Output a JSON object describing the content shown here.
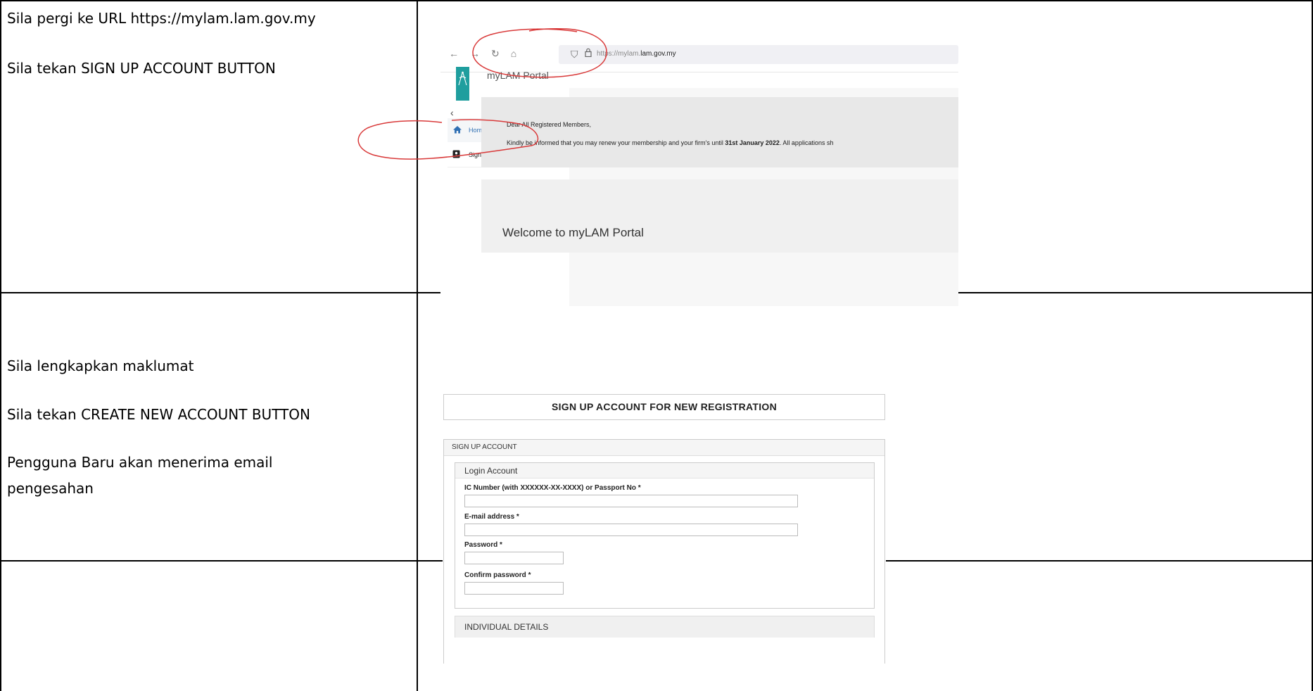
{
  "instructions": {
    "row1_step1": "Sila pergi ke URL https://mylam.lam.gov.my",
    "row1_step2": "Sila tekan SIGN UP ACCOUNT BUTTON",
    "row2_step1": "Sila lengkapkan maklumat",
    "row2_step2": "Sila tekan CREATE NEW ACCOUNT BUTTON",
    "row2_step3_line1": "Pengguna Baru akan menerima email",
    "row2_step3_line2": "pengesahan"
  },
  "browser": {
    "url_prefix": "https://mylam.",
    "url_domain": "lam.gov.my",
    "nav_icons": [
      "back-arrow-icon",
      "forward-arrow-icon",
      "reload-icon",
      "home-icon"
    ],
    "accent_color": "#2f6fb3",
    "logo_color": "#1f9e9e"
  },
  "portal": {
    "title": "myLAM Portal",
    "collapse_glyph": "‹",
    "sidebar": [
      {
        "label": "Home",
        "icon": "home-icon"
      },
      {
        "label": "Sign up Account",
        "icon": "contact-card-icon"
      }
    ],
    "notice_greeting": "Dear All Registered Members,",
    "notice_body_start": "Kindly be informed that you may renew your membership and your firm's until ",
    "notice_body_date": "31st January 2022",
    "notice_body_end": ". All applications sh",
    "welcome": "Welcome to myLAM Portal"
  },
  "form": {
    "header": "SIGN UP ACCOUNT FOR NEW REGISTRATION",
    "panel_title": "SIGN UP ACCOUNT",
    "fieldset_title": "Login Account",
    "fields": [
      {
        "label": "IC Number (with XXXXXX-XX-XXXX) or Passport No *",
        "value": ""
      },
      {
        "label": "E-mail address *",
        "value": ""
      },
      {
        "label": "Password *",
        "value": ""
      },
      {
        "label": "Confirm password *",
        "value": ""
      }
    ],
    "next_section": "INDIVIDUAL DETAILS"
  },
  "annotation_color": "#d93a3a"
}
